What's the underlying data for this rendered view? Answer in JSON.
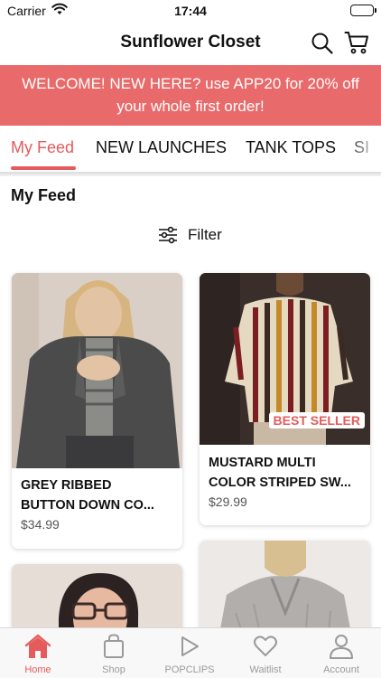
{
  "status_bar": {
    "carrier": "Carrier",
    "time": "17:44"
  },
  "header": {
    "title": "Sunflower Closet"
  },
  "promo": {
    "line1": "WELCOME! NEW HERE? use APP20 for 20% off",
    "line2": "your whole first order!"
  },
  "tabs": [
    {
      "label": "My Feed",
      "active": true
    },
    {
      "label": "NEW LAUNCHES",
      "active": false
    },
    {
      "label": "TANK TOPS",
      "active": false
    },
    {
      "label": "SI",
      "active": false
    }
  ],
  "feed": {
    "title": "My Feed",
    "filter_label": "Filter",
    "products": [
      {
        "name_line1": "GREY RIBBED",
        "name_line2": "BUTTON DOWN CO...",
        "price": "$34.99"
      },
      {
        "name_line1": "MUSTARD MULTI",
        "name_line2": "COLOR STRIPED SW...",
        "price": "$29.99",
        "badge": "BEST SELLER"
      }
    ]
  },
  "bottom_nav": [
    {
      "label": "Home",
      "icon": "home-icon",
      "active": true
    },
    {
      "label": "Shop",
      "icon": "shopping-bag-icon",
      "active": false
    },
    {
      "label": "POPCLIPS",
      "icon": "play-icon",
      "active": false
    },
    {
      "label": "Waitlist",
      "icon": "heart-icon",
      "active": false
    },
    {
      "label": "Account",
      "icon": "person-icon",
      "active": false
    }
  ],
  "colors": {
    "accent": "#e45b5b",
    "promo_bg": "#e96a6a",
    "inactive": "#9a9a9a"
  }
}
